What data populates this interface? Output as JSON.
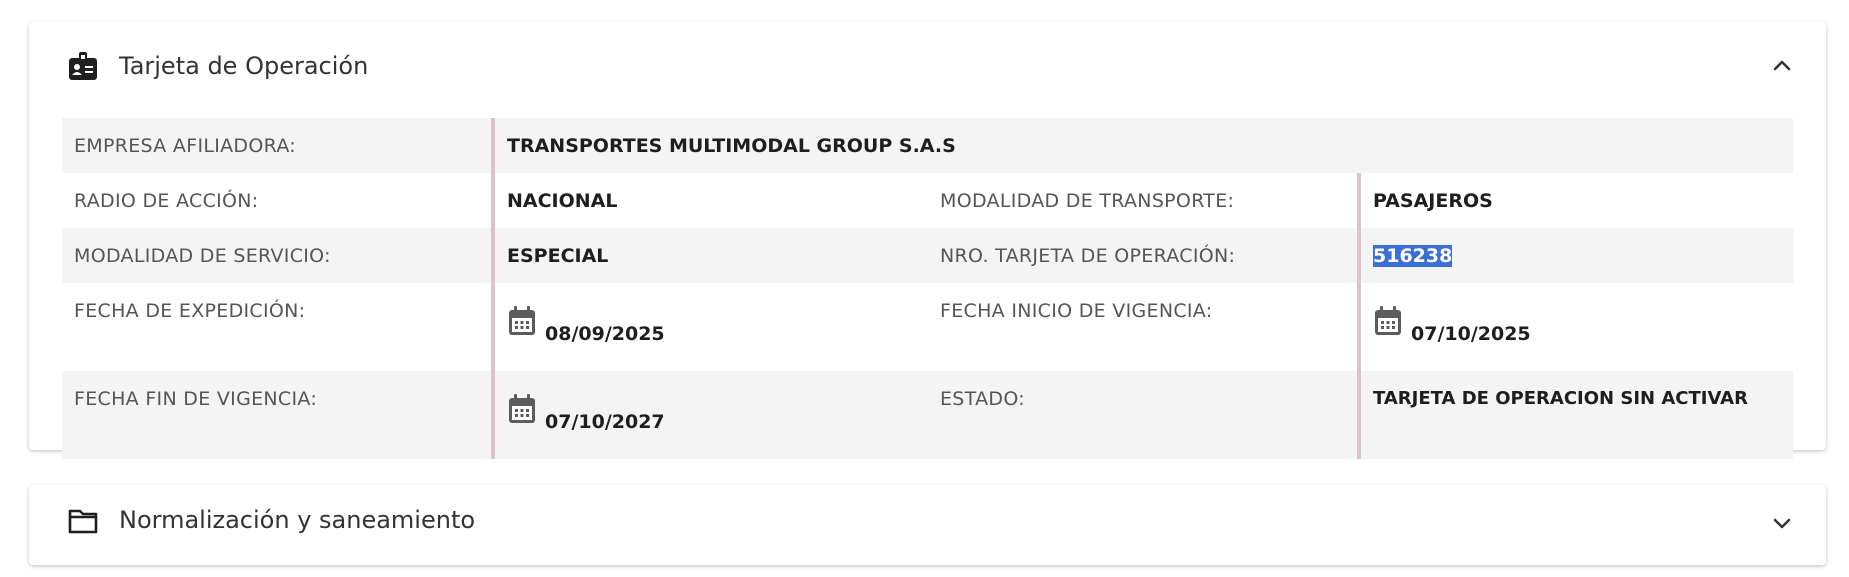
{
  "panels": {
    "operacion": {
      "title": "Tarjeta de Operación",
      "icon": "id-badge-icon",
      "chevron": "chevron-up-icon",
      "rows": [
        {
          "label1": "EMPRESA AFILIADORA:",
          "value1": "TRANSPORTES MULTIMODAL GROUP S.A.S"
        },
        {
          "label1": "RADIO DE ACCIÓN:",
          "value1": "NACIONAL",
          "label2": "MODALIDAD DE TRANSPORTE:",
          "value2": "PASAJEROS"
        },
        {
          "label1": "MODALIDAD DE SERVICIO:",
          "value1": "ESPECIAL",
          "label2": "NRO. TARJETA DE OPERACIÓN:",
          "value2": "516238"
        },
        {
          "label1": "FECHA DE EXPEDICIÓN:",
          "value1": "08/09/2025",
          "label2": "FECHA INICIO DE VIGENCIA:",
          "value2": "07/10/2025"
        },
        {
          "label1": "FECHA FIN DE VIGENCIA:",
          "value1": "07/10/2027",
          "label2": "ESTADO:",
          "value2": "TARJETA DE OPERACION SIN ACTIVAR"
        }
      ]
    },
    "normalizacion": {
      "title": "Normalización y saneamiento",
      "icon": "folder-icon",
      "chevron": "chevron-down-icon"
    }
  },
  "colors": {
    "row_shade": "#f4f4f4",
    "value_border": "#dcc3c6",
    "selection_highlight": "#3b6fd8"
  }
}
